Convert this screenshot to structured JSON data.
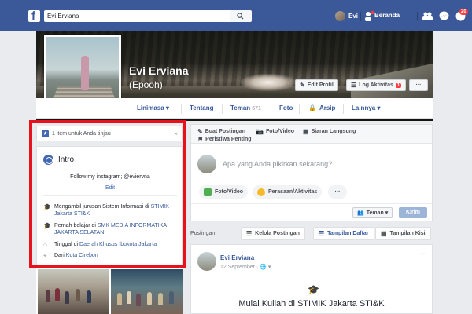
{
  "topbar": {
    "search_value": "Evi Erviana",
    "user_name": "Evi",
    "home_link": "Beranda",
    "notif_count": "20"
  },
  "profile": {
    "name": "Evi Erviana",
    "alt_name": "(Epooh)",
    "edit_profile_label": "Edit Profil",
    "activity_log_label": "Log Aktivitas",
    "activity_log_badge": "1",
    "more_label": "···"
  },
  "nav": {
    "items": [
      {
        "label": "Linimasa ▾"
      },
      {
        "label": "Tentang"
      },
      {
        "label": "Teman",
        "count": "671"
      },
      {
        "label": "Foto"
      },
      {
        "label": "Arsip"
      },
      {
        "label": "Lainnya ▾"
      }
    ]
  },
  "review": {
    "label": "1 item untuk Anda tinjau",
    "close": "×"
  },
  "intro": {
    "title": "Intro",
    "bio": "Follow my instagram; @eviervna",
    "edit": "Edit",
    "items": [
      {
        "text": "Mengambil jurusan Sistem Informasi di ",
        "link": "STIMIK Jakarta STI&K"
      },
      {
        "text": "Pernah belajar di ",
        "link": "SMK MEDIA INFORMATIKA JAKARTA SELATAN"
      },
      {
        "text": "Tinggal di ",
        "link": "Daerah Khusus Ibukota Jakarta"
      },
      {
        "text": "Dari ",
        "link": "Kota Cirebon"
      }
    ]
  },
  "composer": {
    "tab_post": "Buat Postingan",
    "tab_photo": "Foto/Video",
    "tab_live": "Siaran Langsung",
    "tab_event": "Peristiwa Penting",
    "placeholder": "Apa yang Anda pikirkan sekarang?",
    "pill_photo": "Foto/Video",
    "pill_feeling": "Perasaan/Aktivitas",
    "pill_more": "···",
    "audience": "Teman ▾",
    "submit": "Kirim"
  },
  "posts_bar": {
    "label": "Postingan",
    "manage": "Kelola Postingan",
    "list_view": "Tampilan Daftar",
    "grid_view": "Tampilan Kisi"
  },
  "post": {
    "author": "Evi Erviana",
    "date": "12 September · 🌐 ▾",
    "more": "···",
    "cap_icon": "🎓",
    "text": "Mulai Kuliah di STIMIK Jakarta STI&K"
  },
  "colors": {
    "brand": "#3b5998",
    "link": "#365899",
    "highlight_frame": "#e8121c",
    "button_primary_disabled": "#9cb4d8"
  }
}
